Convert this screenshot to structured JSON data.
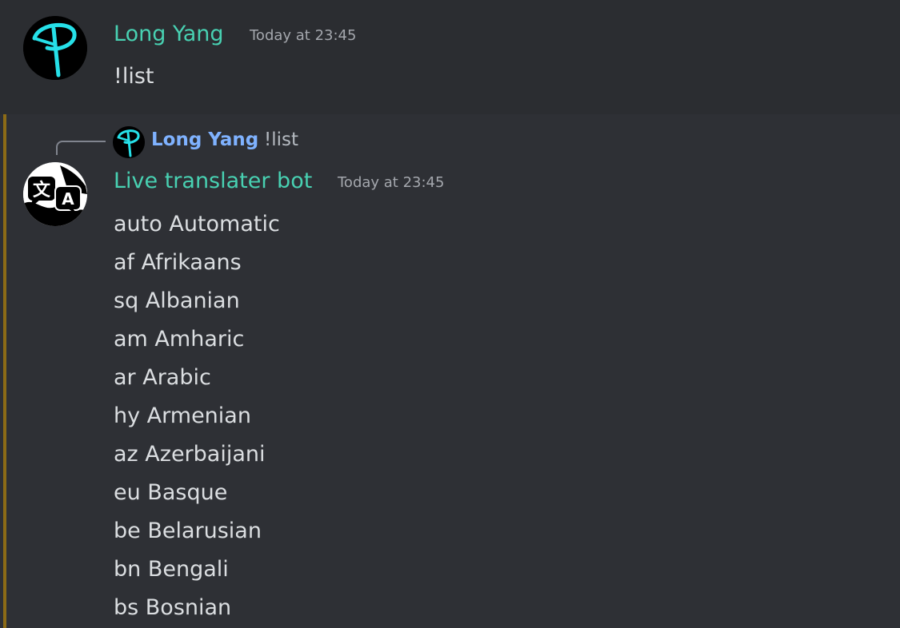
{
  "message1": {
    "author": "Long Yang",
    "timestamp": "Today at 23:45",
    "text": "!list",
    "author_color": "#48d1b2"
  },
  "message2": {
    "reply": {
      "author": "Long Yang",
      "text": "!list",
      "author_color": "#7fb2ff"
    },
    "author": "Live translater bot",
    "timestamp": "Today at 23:45",
    "author_color": "#48d1b2",
    "mention_highlight_color": "#8c6b16",
    "languages": [
      "auto Automatic",
      "af Afrikaans",
      "sq Albanian",
      "am Amharic",
      "ar Arabic",
      "hy Armenian",
      "az Azerbaijani",
      "eu Basque",
      "be Belarusian",
      "bn Bengali",
      "bs Bosnian"
    ]
  },
  "icons": {
    "user_avatar": "cyan-p-logo-avatar-icon",
    "bot_avatar": "translate-bubble-avatar-icon",
    "reply_spine": "reply-connector-icon"
  }
}
